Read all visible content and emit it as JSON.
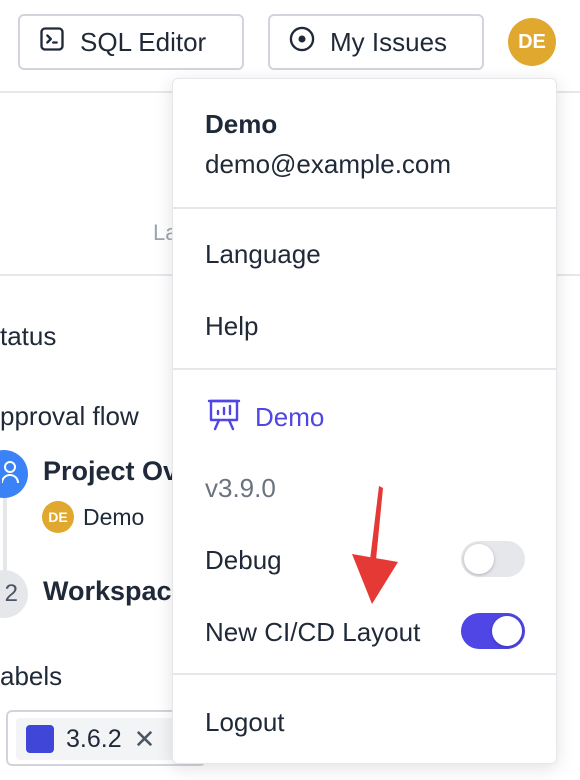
{
  "header": {
    "sql_editor_label": "SQL Editor",
    "my_issues_label": "My Issues",
    "avatar_initials": "DE"
  },
  "background": {
    "partial_tab_label": "La",
    "status_label": "tatus",
    "approval_flow_label": "pproval flow",
    "steps": [
      {
        "number": "",
        "title": "Project Ov",
        "user_initials": "DE",
        "user_name": "Demo"
      },
      {
        "number": "2",
        "title": "Workspac"
      }
    ],
    "labels_label": "abels",
    "label_chip": {
      "text": "3.6.2",
      "remove": "✕"
    }
  },
  "menu": {
    "user_name": "Demo",
    "user_email": "demo@example.com",
    "items": {
      "language": "Language",
      "help": "Help",
      "workspace": "Demo",
      "version": "v3.9.0",
      "debug": "Debug",
      "new_cicd_layout": "New CI/CD Layout",
      "logout": "Logout"
    },
    "toggles": {
      "debug_enabled": false,
      "new_cicd_layout_enabled": true
    }
  },
  "colors": {
    "avatar_bg": "#e0a82e",
    "accent": "#4f46e5",
    "annotation_arrow": "#e53935"
  }
}
